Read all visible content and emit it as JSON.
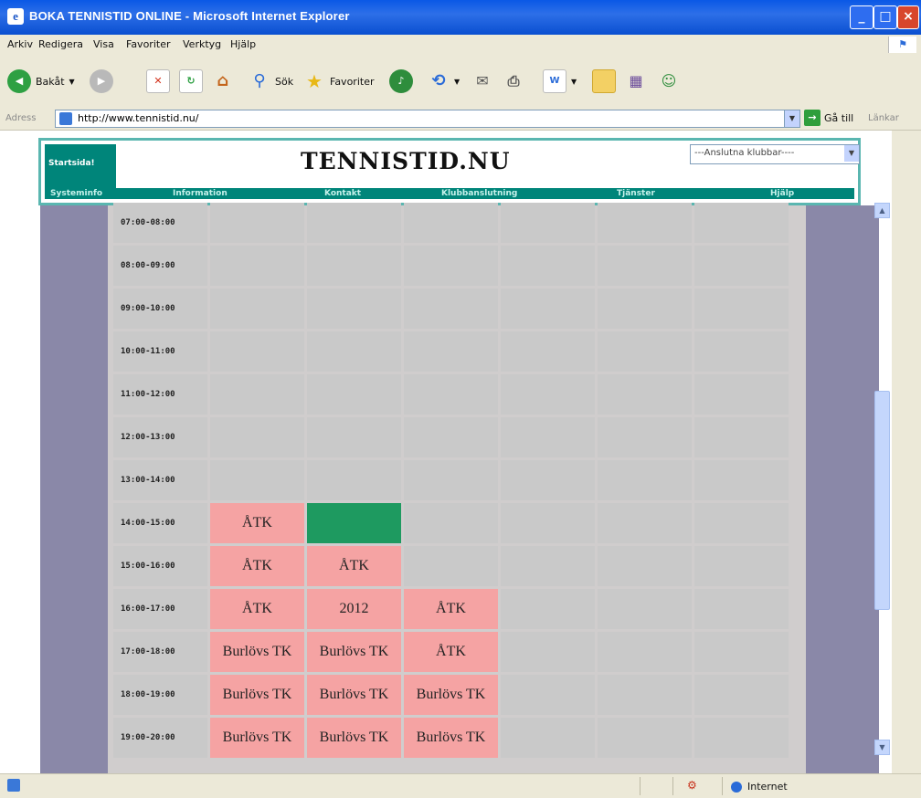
{
  "window": {
    "title": "BOKA TENNISTID ONLINE - Microsoft Internet Explorer"
  },
  "menu": [
    "Arkiv",
    "Redigera",
    "Visa",
    "Favoriter",
    "Verktyg",
    "Hjälp"
  ],
  "toolbar": {
    "back": "Bakåt",
    "search": "Sök",
    "favorites": "Favoriter"
  },
  "address": {
    "label": "Adress",
    "url": "http://www.tennistid.nu/",
    "go": "Gå till",
    "links": "Länkar"
  },
  "site": {
    "logo_text": "Startsida!",
    "title": "TENNISTID.NU",
    "club_select": "---Anslutna klubbar----",
    "nav": [
      "Systeminfo",
      "Information",
      "Kontakt",
      "Klubbanslutning",
      "Tjänster",
      "Hjälp"
    ]
  },
  "schedule": {
    "rows": [
      {
        "time": "07:00-08:00",
        "cells": [
          "",
          "",
          "",
          "",
          "",
          ""
        ]
      },
      {
        "time": "08:00-09:00",
        "cells": [
          "",
          "",
          "",
          "",
          "",
          ""
        ]
      },
      {
        "time": "09:00-10:00",
        "cells": [
          "",
          "",
          "",
          "",
          "",
          ""
        ]
      },
      {
        "time": "10:00-11:00",
        "cells": [
          "",
          "",
          "",
          "",
          "",
          ""
        ]
      },
      {
        "time": "11:00-12:00",
        "cells": [
          "",
          "",
          "",
          "",
          "",
          ""
        ]
      },
      {
        "time": "12:00-13:00",
        "cells": [
          "",
          "",
          "",
          "",
          "",
          ""
        ]
      },
      {
        "time": "13:00-14:00",
        "cells": [
          "",
          "",
          "",
          "",
          "",
          ""
        ]
      },
      {
        "time": "14:00-15:00",
        "cells": [
          "ÅTK",
          "",
          "",
          "",
          "",
          ""
        ]
      },
      {
        "time": "15:00-16:00",
        "cells": [
          "ÅTK",
          "ÅTK",
          "",
          "",
          "",
          ""
        ]
      },
      {
        "time": "16:00-17:00",
        "cells": [
          "ÅTK",
          "2012",
          "ÅTK",
          "",
          "",
          ""
        ]
      },
      {
        "time": "17:00-18:00",
        "cells": [
          "Burlövs TK",
          "Burlövs TK",
          "ÅTK",
          "",
          "",
          ""
        ]
      },
      {
        "time": "18:00-19:00",
        "cells": [
          "Burlövs TK",
          "Burlövs TK",
          "Burlövs TK",
          "",
          "",
          ""
        ]
      },
      {
        "time": "19:00-20:00",
        "cells": [
          "Burlövs TK",
          "Burlövs TK",
          "Burlövs TK",
          "",
          "",
          ""
        ]
      }
    ],
    "status": [
      [
        "free",
        "free",
        "free",
        "free",
        "free",
        "free"
      ],
      [
        "free",
        "free",
        "free",
        "free",
        "free",
        "free"
      ],
      [
        "free",
        "free",
        "free",
        "free",
        "free",
        "free"
      ],
      [
        "free",
        "free",
        "free",
        "free",
        "free",
        "free"
      ],
      [
        "free",
        "free",
        "free",
        "free",
        "free",
        "free"
      ],
      [
        "free",
        "free",
        "free",
        "free",
        "free",
        "free"
      ],
      [
        "free",
        "free",
        "free",
        "free",
        "free",
        "free"
      ],
      [
        "booked",
        "selected",
        "free",
        "free",
        "free",
        "free"
      ],
      [
        "booked",
        "booked",
        "free",
        "free",
        "free",
        "free"
      ],
      [
        "booked",
        "booked",
        "booked",
        "free",
        "free",
        "free"
      ],
      [
        "booked",
        "booked",
        "booked",
        "free",
        "free",
        "free"
      ],
      [
        "booked",
        "booked",
        "booked",
        "free",
        "free",
        "free"
      ],
      [
        "booked",
        "booked",
        "booked",
        "free",
        "free",
        "free"
      ]
    ]
  },
  "statusbar": {
    "zone": "Internet"
  },
  "colors": {
    "booked": "#f5a3a3",
    "selected": "#1e9a60",
    "free": "#c9c9c9",
    "accent": "#00857a",
    "sidebar": "#8a88a8"
  }
}
